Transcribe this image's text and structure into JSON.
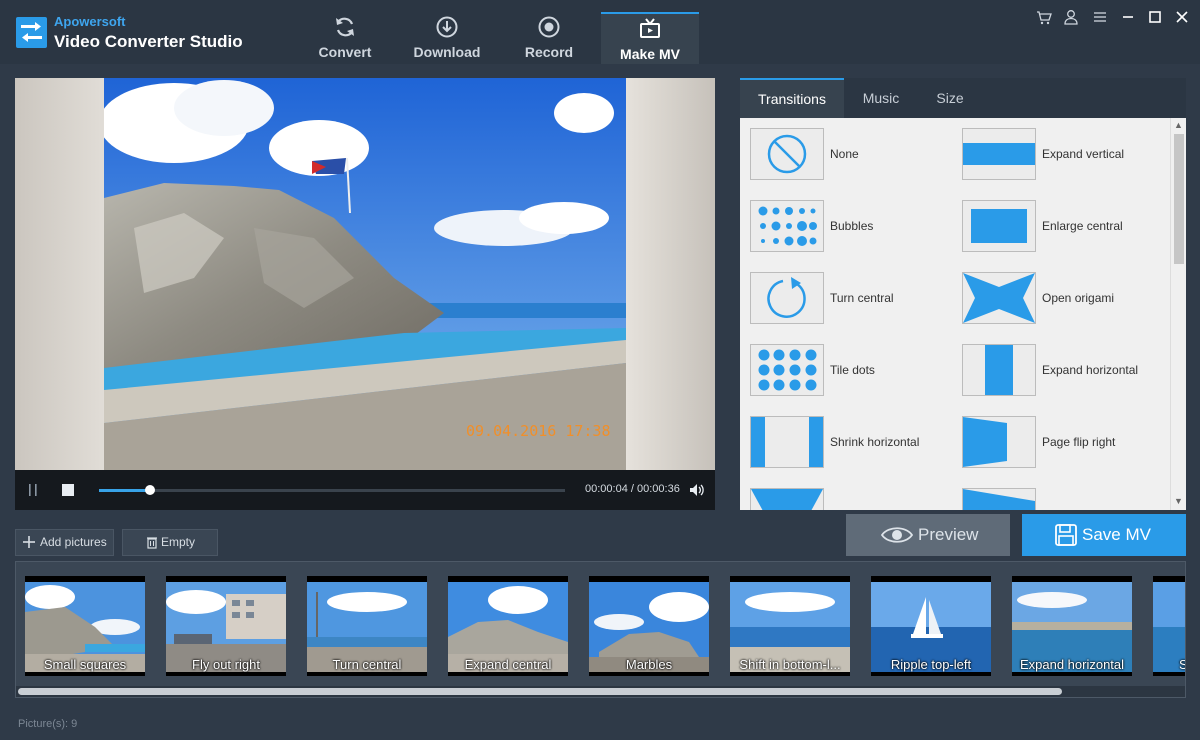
{
  "app": {
    "brand_top": "Apowersoft",
    "brand_main": "Video Converter Studio"
  },
  "nav": [
    {
      "label": "Convert",
      "icon": "refresh-icon"
    },
    {
      "label": "Download",
      "icon": "download-icon"
    },
    {
      "label": "Record",
      "icon": "record-icon"
    },
    {
      "label": "Make MV",
      "icon": "tv-icon",
      "active": true
    }
  ],
  "window_controls": [
    "cart-icon",
    "user-icon",
    "menu-icon",
    "minimize-icon",
    "maximize-icon",
    "close-icon"
  ],
  "player": {
    "stamp": "09.04.2016 17:38",
    "time": "00:00:04 / 00:00:36",
    "progress": 0.11
  },
  "panel_tabs": [
    {
      "label": "Transitions",
      "active": true
    },
    {
      "label": "Music"
    },
    {
      "label": "Size"
    }
  ],
  "transitions": [
    {
      "name": "None",
      "icon": "none-icon"
    },
    {
      "name": "Expand vertical",
      "icon": "expand-vertical-icon"
    },
    {
      "name": "Bubbles",
      "icon": "bubbles-icon"
    },
    {
      "name": "Enlarge central",
      "icon": "enlarge-central-icon"
    },
    {
      "name": "Turn central",
      "icon": "turn-central-icon"
    },
    {
      "name": "Open origami",
      "icon": "open-origami-icon"
    },
    {
      "name": "Tile dots",
      "icon": "tile-dots-icon"
    },
    {
      "name": "Expand horizontal",
      "icon": "expand-horizontal-icon"
    },
    {
      "name": "Shrink horizontal",
      "icon": "shrink-horizontal-icon"
    },
    {
      "name": "Page flip right",
      "icon": "page-flip-right-icon"
    }
  ],
  "actions": {
    "add_pictures": "Add pictures",
    "empty": "Empty",
    "preview": "Preview",
    "save_mv": "Save MV"
  },
  "colors": {
    "accent": "#2a9be8",
    "background": "#2f3a48",
    "panel": "#f0f0f0"
  },
  "storyboard": [
    {
      "caption": "Small squares"
    },
    {
      "caption": "Fly out right"
    },
    {
      "caption": "Turn central"
    },
    {
      "caption": "Expand central"
    },
    {
      "caption": "Marbles"
    },
    {
      "caption": "Shift in bottom-l..."
    },
    {
      "caption": "Ripple top-left"
    },
    {
      "caption": "Expand horizontal"
    },
    {
      "caption": "S"
    }
  ],
  "status": "Picture(s): 9"
}
